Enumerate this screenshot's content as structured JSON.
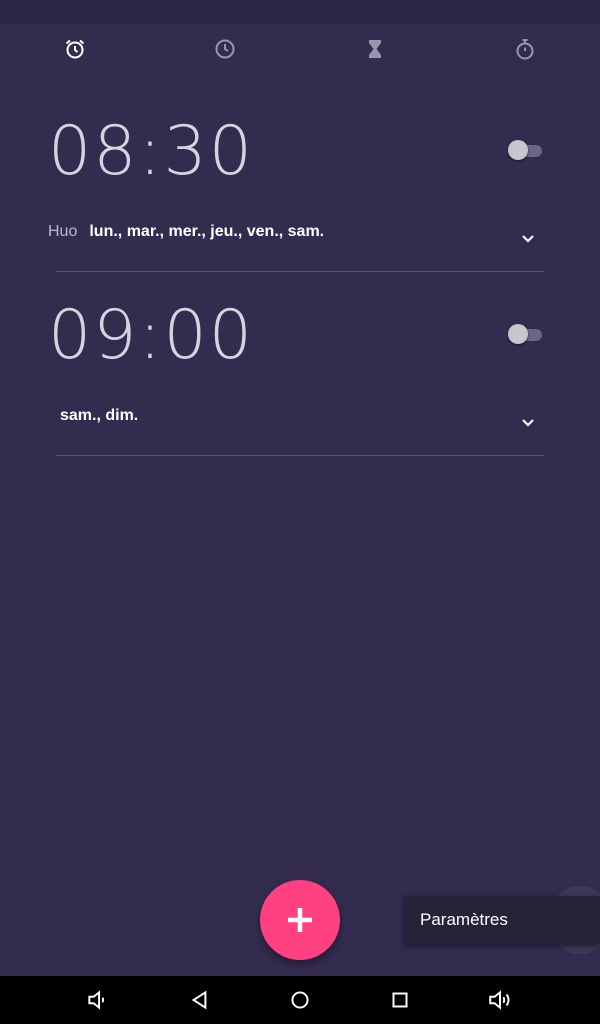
{
  "tabs": [
    {
      "icon": "alarm-icon",
      "selected": true
    },
    {
      "icon": "clock-icon",
      "selected": false
    },
    {
      "icon": "timer-hourglass-icon",
      "selected": false
    },
    {
      "icon": "stopwatch-icon",
      "selected": false
    }
  ],
  "alarms": [
    {
      "time": "08:30",
      "label": "Huo",
      "days": "lun., mar., mer., jeu., ven., sam.",
      "enabled": false
    },
    {
      "time": "09:00",
      "label": "",
      "days": "sam., dim.",
      "enabled": false
    }
  ],
  "menu": {
    "items": [
      {
        "label": "Paramètres"
      }
    ]
  },
  "fab": {
    "icon": "plus-icon"
  },
  "navigation": {
    "icons": [
      "volume-down-icon",
      "back-icon",
      "home-icon",
      "recents-icon",
      "volume-up-icon"
    ]
  },
  "colors": {
    "background": "#342c4f",
    "accent": "#ff4081",
    "time_text": "#d6d2de"
  }
}
